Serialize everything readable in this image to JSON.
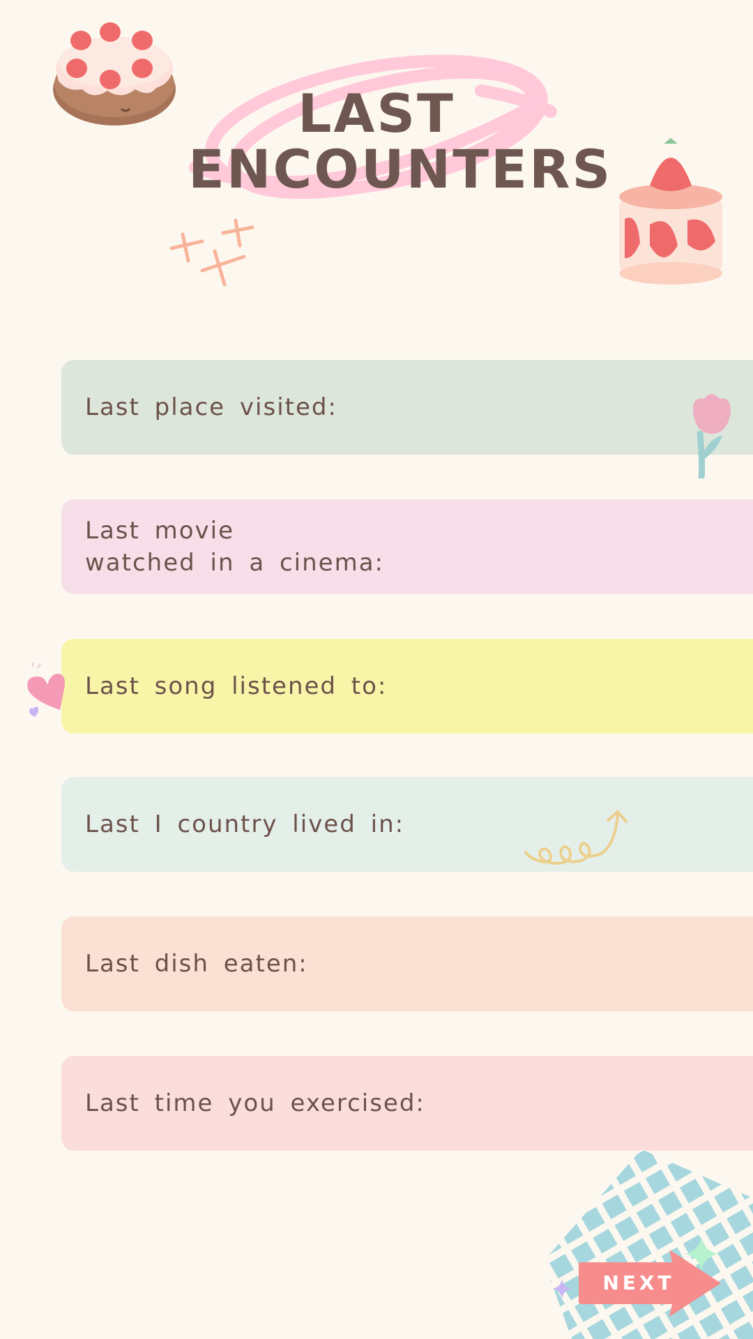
{
  "title": {
    "line1": "LAST",
    "line2": "ENCOUNTERS"
  },
  "prompts": [
    {
      "label": "Last place visited:",
      "color": "#dde6db"
    },
    {
      "label": "Last movie\nwatched in a cinema:",
      "color": "#f6dfe8"
    },
    {
      "label": "Last song listened to:",
      "color": "#f8f5a8"
    },
    {
      "label": "Last I country lived in:",
      "color": "#e5efea"
    },
    {
      "label": "Last dish eaten:",
      "color": "#fbe0d4"
    },
    {
      "label": "Last time you exercised:",
      "color": "#fbdedc"
    }
  ],
  "next_button": {
    "label": "NEXT",
    "color": "#f78c8c"
  },
  "colors": {
    "background": "#fdf8ef",
    "text": "#6b514a",
    "scribble": "#ffc9da"
  },
  "icons": [
    "cake-icon",
    "strawberry-cake-icon",
    "sparkle-icon",
    "tulip-icon",
    "heart-icon",
    "squiggle-arrow-icon",
    "grid-sticker-icon",
    "star-icon"
  ]
}
